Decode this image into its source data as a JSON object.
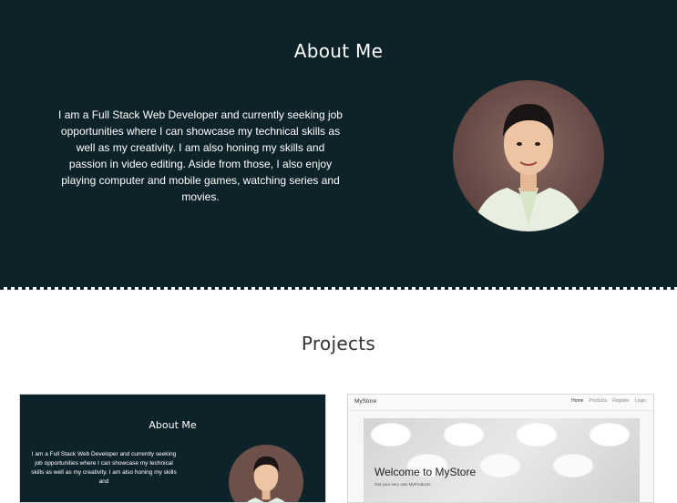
{
  "about": {
    "title": "About Me",
    "bio": "I am a Full Stack Web Developer and currently seeking job opportunities where I can showcase my technical skills as well as my creativity. I am also honing my skills and passion in video editing. Aside from those, I also enjoy playing computer and mobile games, watching series and movies."
  },
  "projects": {
    "title": "Projects",
    "cards": [
      {
        "title": "About Me",
        "text": "I am a Full Stack Web Developer and currently seeking job opportunities where I can showcase my technical skills as well as my creativity. I am also honing my skills and"
      },
      {
        "brand": "MyStore",
        "nav": [
          "Home",
          "Products",
          "Register",
          "Login"
        ],
        "welcome": "Welcome to MyStore",
        "subtitle": "Get your very own MyProducts"
      }
    ]
  },
  "colors": {
    "about_bg": "#0d2329",
    "text_light": "#ffffff",
    "heading_dark": "#333333"
  }
}
